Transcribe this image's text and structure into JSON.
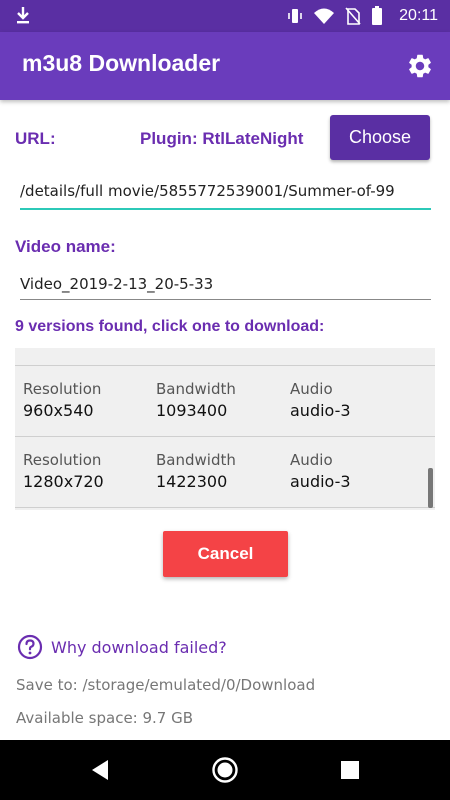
{
  "status_bar": {
    "time": "20:11"
  },
  "app_bar": {
    "title": "m3u8 Downloader"
  },
  "url": {
    "label": "URL:",
    "plugin_label": "Plugin: RtlLateNight",
    "choose_label": "Choose",
    "value": "/details/full movie/5855772539001/Summer-of-99"
  },
  "video_name": {
    "label": "Video name:",
    "value": "Video_2019-2-13_20-5-33"
  },
  "versions": {
    "header": "9 versions found, click one to download:",
    "rows": [
      {
        "resolution_label": "Resolution",
        "resolution": "960x540",
        "bandwidth_label": "Bandwidth",
        "bandwidth": "1093400",
        "audio_label": "Audio",
        "audio": "audio-3"
      },
      {
        "resolution_label": "Resolution",
        "resolution": "1280x720",
        "bandwidth_label": "Bandwidth",
        "bandwidth": "1422300",
        "audio_label": "Audio",
        "audio": "audio-3"
      }
    ]
  },
  "cancel_label": "Cancel",
  "help_link": "Why download failed?",
  "save_to": "Save to: /storage/emulated/0/Download",
  "available_space": "Available space: 9.7 GB",
  "colors": {
    "status_bar": "#5a2fa3",
    "app_bar": "#6a3cbc",
    "accent": "#6a2db0",
    "input_focus": "#2cc9b8",
    "cancel": "#f44346"
  }
}
